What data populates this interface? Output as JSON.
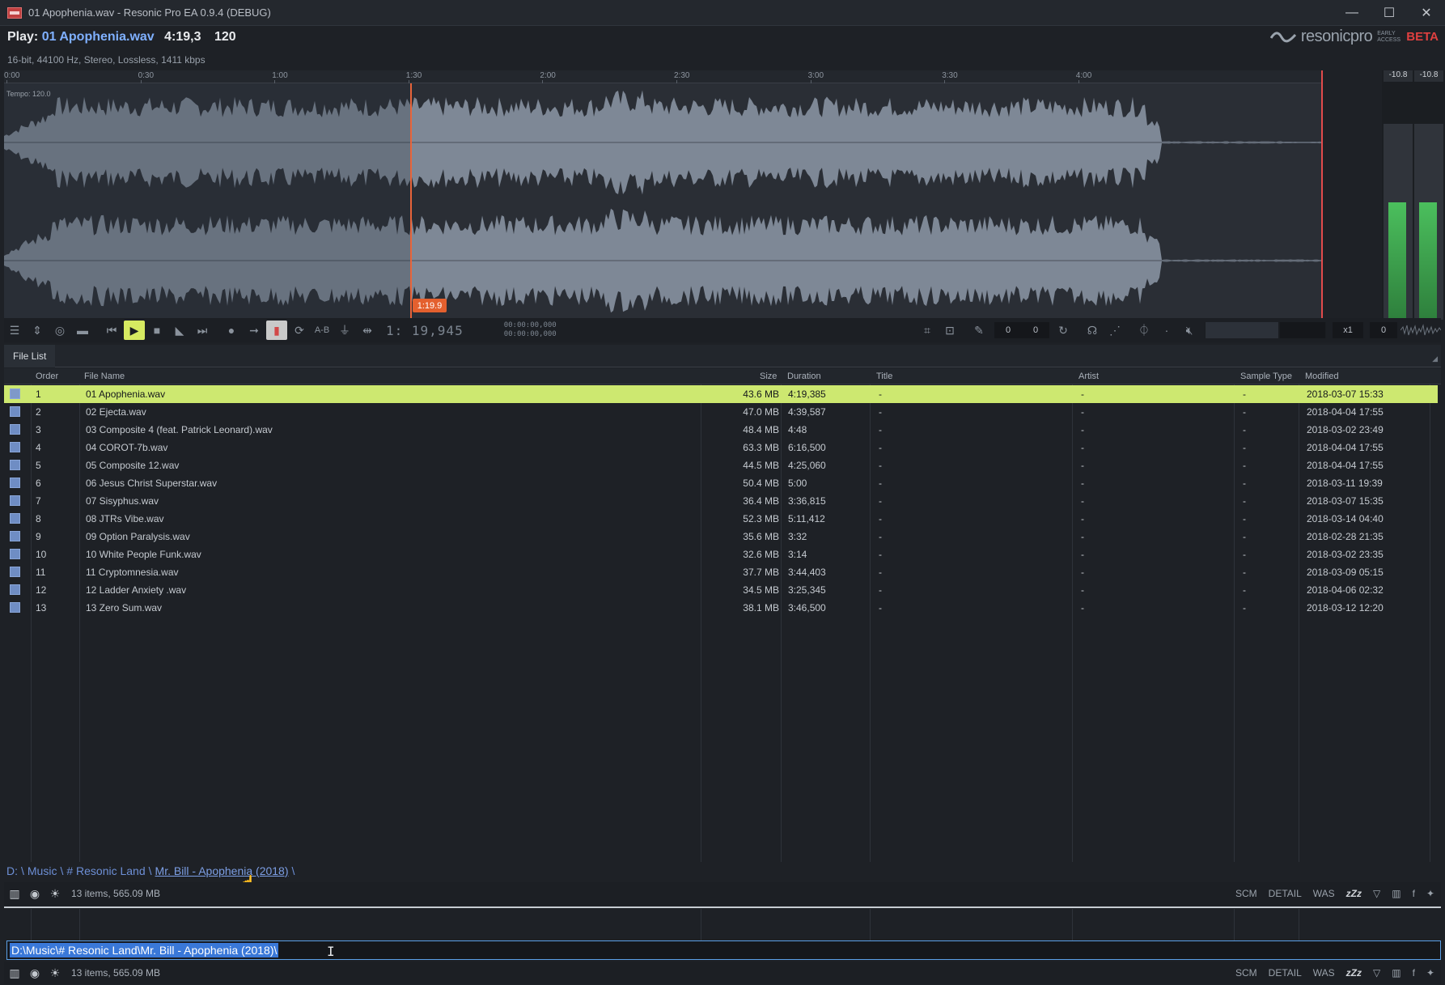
{
  "window": {
    "title": "01 Apophenia.wav - Resonic Pro EA 0.9.4 (DEBUG)",
    "minimize": "—",
    "maximize": "☐",
    "close": "✕"
  },
  "header": {
    "play_prefix": "Play:",
    "file_name": "01 Apophenia.wav",
    "duration": "4:19,3",
    "bpm": "120",
    "file_info": "16-bit, 44100 Hz, Stereo, Lossless, 1411 kbps",
    "logo_text": "resonicpro",
    "logo_early_access": "EARLY ACCESS",
    "logo_beta": "BETA"
  },
  "timeline": {
    "ticks": [
      "0:00",
      "0:30",
      "1:00",
      "1:30",
      "2:00",
      "2:30",
      "3:00",
      "3:30",
      "4:00"
    ],
    "tempo_label": "Tempo: 120.0",
    "playhead_label": "1:19.9"
  },
  "meters": {
    "left_peak": "-10.8",
    "right_peak": "-10.8",
    "left_level": 0.6,
    "right_level": 0.6
  },
  "transport": {
    "counter": "1: 19,945",
    "smpte_top": "00:00:00,000",
    "smpte_bottom": "00:00:00,000",
    "ab_label": "A-B",
    "trim_left": "0",
    "trim_right": "0",
    "speed": "x1",
    "pitch": "0"
  },
  "file_list": {
    "tab_label": "File List",
    "columns": {
      "order": "Order",
      "file_name": "File Name",
      "size": "Size",
      "duration": "Duration",
      "title": "Title",
      "artist": "Artist",
      "sample_type": "Sample Type",
      "modified": "Modified"
    },
    "rows": [
      {
        "order": "1",
        "name": "01 Apophenia.wav",
        "size": "43.6 MB",
        "duration": "4:19,385",
        "title": "-",
        "artist": "-",
        "sample_type": "-",
        "modified": "2018-03-07 15:33"
      },
      {
        "order": "2",
        "name": "02 Ejecta.wav",
        "size": "47.0 MB",
        "duration": "4:39,587",
        "title": "-",
        "artist": "-",
        "sample_type": "-",
        "modified": "2018-04-04 17:55"
      },
      {
        "order": "3",
        "name": "03 Composite 4 (feat. Patrick Leonard).wav",
        "size": "48.4 MB",
        "duration": "4:48",
        "title": "-",
        "artist": "-",
        "sample_type": "-",
        "modified": "2018-03-02 23:49"
      },
      {
        "order": "4",
        "name": "04 COROT-7b.wav",
        "size": "63.3 MB",
        "duration": "6:16,500",
        "title": "-",
        "artist": "-",
        "sample_type": "-",
        "modified": "2018-04-04 17:55"
      },
      {
        "order": "5",
        "name": "05 Composite 12.wav",
        "size": "44.5 MB",
        "duration": "4:25,060",
        "title": "-",
        "artist": "-",
        "sample_type": "-",
        "modified": "2018-04-04 17:55"
      },
      {
        "order": "6",
        "name": "06 Jesus Christ Superstar.wav",
        "size": "50.4 MB",
        "duration": "5:00",
        "title": "-",
        "artist": "-",
        "sample_type": "-",
        "modified": "2018-03-11 19:39"
      },
      {
        "order": "7",
        "name": "07 Sisyphus.wav",
        "size": "36.4 MB",
        "duration": "3:36,815",
        "title": "-",
        "artist": "-",
        "sample_type": "-",
        "modified": "2018-03-07 15:35"
      },
      {
        "order": "8",
        "name": "08 JTRs Vibe.wav",
        "size": "52.3 MB",
        "duration": "5:11,412",
        "title": "-",
        "artist": "-",
        "sample_type": "-",
        "modified": "2018-03-14 04:40"
      },
      {
        "order": "9",
        "name": "09 Option Paralysis.wav",
        "size": "35.6 MB",
        "duration": "3:32",
        "title": "-",
        "artist": "-",
        "sample_type": "-",
        "modified": "2018-02-28 21:35"
      },
      {
        "order": "10",
        "name": "10 White People Funk.wav",
        "size": "32.6 MB",
        "duration": "3:14",
        "title": "-",
        "artist": "-",
        "sample_type": "-",
        "modified": "2018-03-02 23:35"
      },
      {
        "order": "11",
        "name": "11 Cryptomnesia.wav",
        "size": "37.7 MB",
        "duration": "3:44,403",
        "title": "-",
        "artist": "-",
        "sample_type": "-",
        "modified": "2018-03-09 05:15"
      },
      {
        "order": "12",
        "name": "12 Ladder Anxiety .wav",
        "size": "34.5 MB",
        "duration": "3:25,345",
        "title": "-",
        "artist": "-",
        "sample_type": "-",
        "modified": "2018-04-06 02:32"
      },
      {
        "order": "13",
        "name": "13 Zero Sum.wav",
        "size": "38.1 MB",
        "duration": "3:46,500",
        "title": "-",
        "artist": "-",
        "sample_type": "-",
        "modified": "2018-03-12 12:20"
      }
    ]
  },
  "breadcrumb": {
    "items": [
      "D:",
      "Music",
      "# Resonic Land",
      "Mr. Bill - Apophenia (2018)"
    ],
    "separator": "\\"
  },
  "status": {
    "summary": "13 items, 565.09 MB",
    "buttons": [
      "SCM",
      "DETAIL",
      "WAS",
      "zZz"
    ]
  },
  "path_input": {
    "value": "D:\\Music\\# Resonic Land\\Mr. Bill - Apophenia (2018)\\"
  },
  "colors": {
    "selected_row": "#cde870",
    "play_button": "#d6ea61",
    "playhead": "#e8643a",
    "link": "#6d8fd6",
    "beta": "#e04040"
  }
}
